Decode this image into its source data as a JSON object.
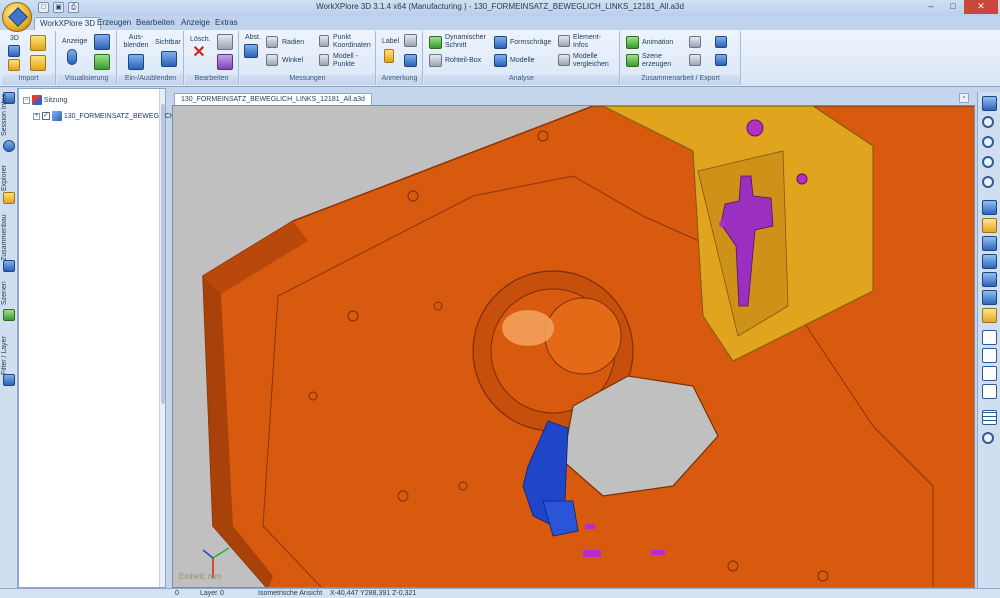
{
  "window": {
    "title": "WorkXPlore 3D 3.1.4 x64 (Manufacturing ) - 130_FORMEINSATZ_BEWEGLICH_LINKS_12181_All.a3d"
  },
  "ribbon_tabs": [
    {
      "label": "WorkXPlore 3D",
      "active": true
    },
    {
      "label": "Erzeugen",
      "active": false
    },
    {
      "label": "Bearbeiten",
      "active": false
    },
    {
      "label": "Anzeige",
      "active": false
    },
    {
      "label": "Extras",
      "active": false
    }
  ],
  "groups": {
    "import": {
      "label": "Import",
      "btn_3d": "3D"
    },
    "visualisierung": {
      "label": "Visualisierung",
      "anzeige": "Anzeige"
    },
    "einaus": {
      "label": "Ein-/Ausblenden",
      "ausblenden": "Aus-\nblenden",
      "sichtbar": "Sichtbar"
    },
    "bearbeiten": {
      "label": "Bearbeiten",
      "loesch": "Lösch."
    },
    "messungen": {
      "label": "Messungen",
      "abst": "Abst.",
      "radien": "Radien",
      "winkel": "Winkel",
      "punkt_koord_1": "Punkt",
      "punkt_koord_2": "Koordinaten",
      "modell_punkte_1": "Modell -",
      "modell_punkte_2": "Punkte"
    },
    "anmerkung": {
      "label": "Anmerkung",
      "label_btn": "Label"
    },
    "analyse": {
      "label": "Analyse",
      "dyn_schnitt_1": "Dynamischer",
      "dyn_schnitt_2": "Schnitt",
      "rohteil": "Rohteil-Box",
      "formschraege": "Formschräge",
      "modelle": "Modelle",
      "element_1": "Element-",
      "element_2": "Infos",
      "vergleichen_1": "Modelle",
      "vergleichen_2": "vergleichen"
    },
    "zusammenarbeit": {
      "label": "Zusammenarbeit / Export",
      "animation": "Animation",
      "szene_1": "Szene",
      "szene_2": "erzeugen"
    }
  },
  "left_tabs": {
    "session_info": "Session Infos",
    "explorer": "Explorer",
    "zusammenbau": "Zusammenbau",
    "szenen": "Szenen",
    "filter": "Filter / Layer"
  },
  "tree": {
    "root": "Sitzung",
    "child": "130_FORMEINSATZ_BEWEGLICH"
  },
  "document": {
    "tab_label": "130_FORMEINSATZ_BEWEGLICH_LINKS_12181_All.a3d",
    "units_label": "Einheit: mm",
    "colors": {
      "background": "#c0c0c0",
      "plate": "#d85a0e",
      "plate_dark": "#a8420a",
      "insert": "#e0a41f",
      "blue_part": "#1f46c8",
      "magenta_part": "#b52fc7"
    }
  },
  "statusbar": {
    "count": "0",
    "layer_label": "Layer",
    "layer_value": "0",
    "view": "Isometrische Ansicht",
    "coords": "X-40,447 Y288,391 Z-0,321"
  }
}
